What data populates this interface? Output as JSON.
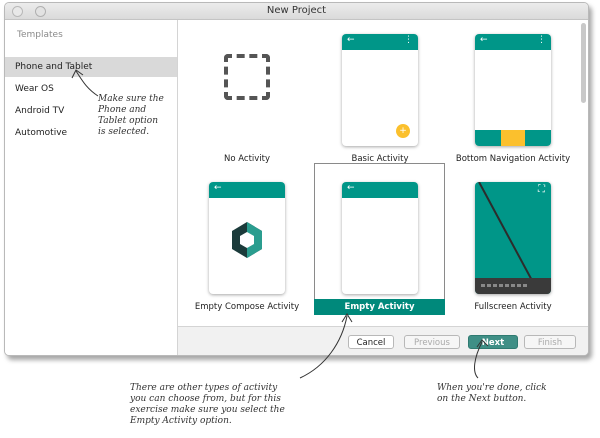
{
  "window": {
    "title": "New Project"
  },
  "sidebar": {
    "header": "Templates",
    "items": [
      {
        "label": "Phone and Tablet",
        "selected": true
      },
      {
        "label": "Wear OS"
      },
      {
        "label": "Android TV"
      },
      {
        "label": "Automotive"
      }
    ]
  },
  "templates": [
    {
      "label": "No Activity"
    },
    {
      "label": "Basic Activity"
    },
    {
      "label": "Bottom Navigation Activity"
    },
    {
      "label": "Empty Compose Activity"
    },
    {
      "label": "Empty Activity",
      "selected": true
    },
    {
      "label": "Fullscreen Activity"
    }
  ],
  "phone_icons": {
    "back": "←",
    "more": "⋮",
    "fab": "+",
    "expand": "⛶"
  },
  "buttons": {
    "cancel": "Cancel",
    "previous": "Previous",
    "next": "Next",
    "finish": "Finish"
  },
  "annotations": {
    "sidebar_note": [
      "Make sure the",
      "Phone and",
      "Tablet option",
      "is selected."
    ],
    "bottom_left_note": [
      "There are other types of activity",
      "you can choose from, but for this",
      "exercise make sure you select the",
      "Empty Activity option."
    ],
    "bottom_right_note": [
      "When you're done, click",
      "on the Next button."
    ]
  },
  "colors": {
    "teal": "#009688",
    "accent": "#fbc02d",
    "selection": "#00897b"
  }
}
